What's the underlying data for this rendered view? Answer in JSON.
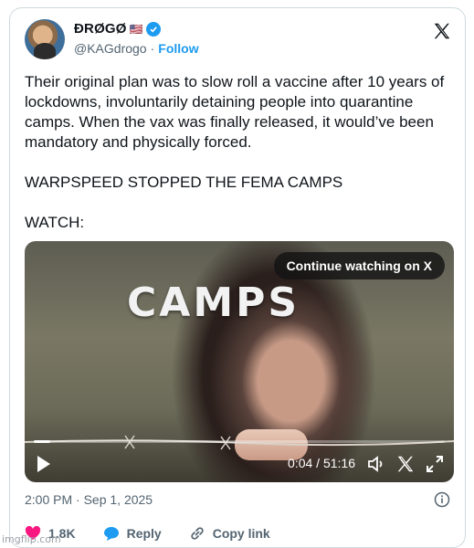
{
  "author": {
    "display_name": "ÐRØGØ",
    "flag": "🇺🇸",
    "handle": "@KAGdrogo",
    "separator": "·",
    "follow_label": "Follow"
  },
  "tweet": {
    "text": "Their original plan was to slow roll a vaccine after 10 years of lockdowns, involuntarily detaining people into quarantine camps. When the vax was finally released, it would’ve been mandatory and physically forced.\n\nWARPSPEED STOPPED THE FEMA CAMPS\n\nWATCH:"
  },
  "video": {
    "title_overlay": "CAMPS",
    "continue_label": "Continue watching on X",
    "timecode": "0:04 / 51:16",
    "progress_fraction": 0.0013
  },
  "meta": {
    "timestamp": "2:00 PM · Sep 1, 2025"
  },
  "actions": {
    "likes": "1.8K",
    "reply_label": "Reply",
    "copy_link_label": "Copy link"
  },
  "watermark": "imgflip.com",
  "colors": {
    "accent": "#1d9bf0",
    "like": "#f91880",
    "muted": "#536471"
  }
}
